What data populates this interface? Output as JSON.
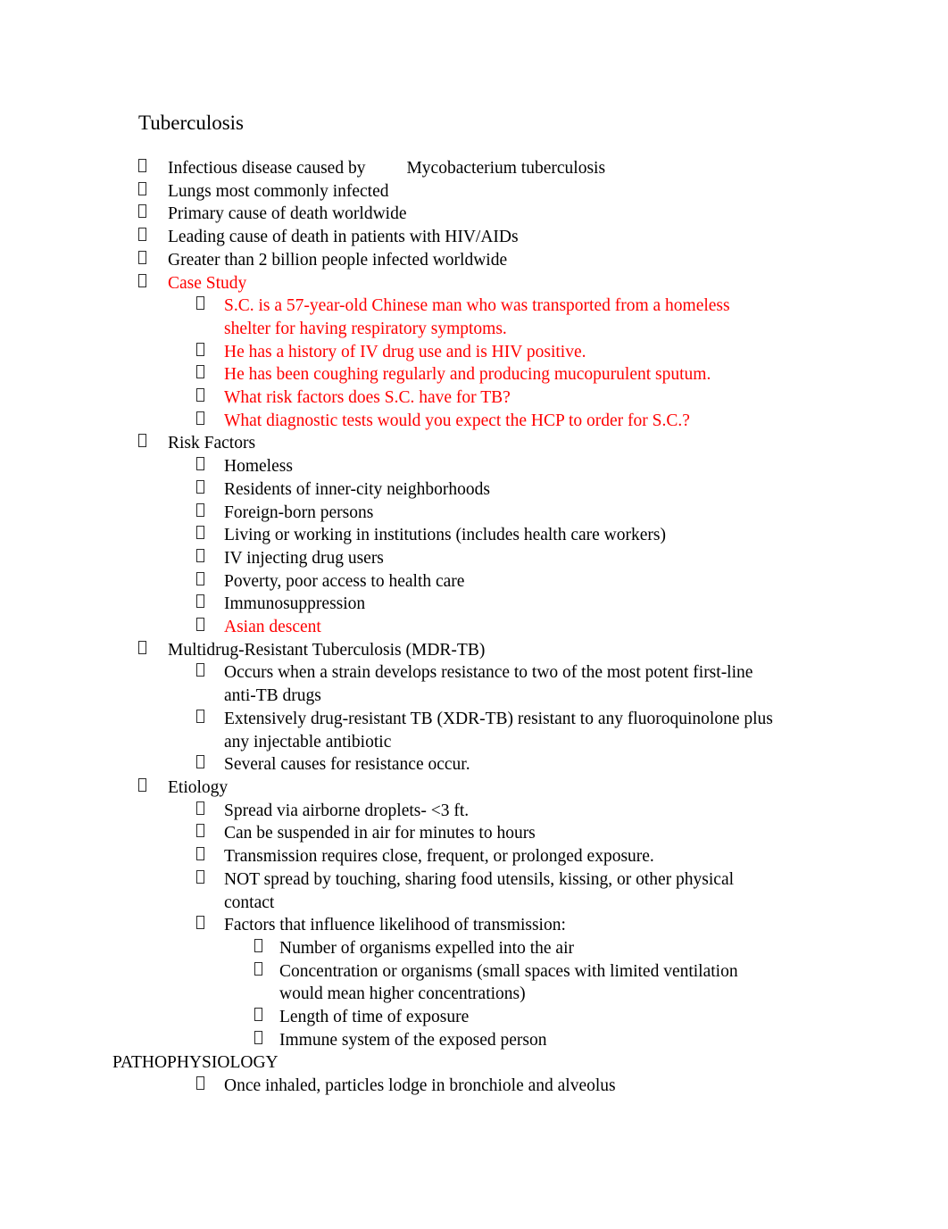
{
  "document": {
    "title": "Tuberculosis",
    "colors": {
      "text": "#000000",
      "highlight_red": "#ff0000",
      "background": "#ffffff",
      "bullet_outline": "#2b2b2b"
    },
    "bullet_glyph": "missing-glyph-box"
  },
  "outline": {
    "l1_infectious_a": "Infectious disease caused by",
    "l1_infectious_b": "Mycobacterium tuberculosis",
    "l1_lungs": "Lungs most commonly infected",
    "l1_primary_cause": "Primary cause of death worldwide",
    "l1_leading_cause": "Leading cause of death in patients with HIV/AIDs",
    "l1_greater_than": "Greater than 2 billion people infected worldwide",
    "l1_case_study": "Case Study",
    "case_study": {
      "item1": "S.C. is a 57-year-old Chinese man who was transported from a homeless shelter for having respiratory symptoms.",
      "item2": "He has a history of IV drug use and is HIV positive.",
      "item3": "He has been coughing regularly and producing mucopurulent sputum.",
      "item4": "What risk factors does S.C. have for TB?",
      "item5": "What diagnostic tests would you expect the HCP to order for S.C.?"
    },
    "l1_risk_factors": "Risk Factors",
    "risk_factors": {
      "item1": "Homeless",
      "item2": "Residents of inner-city neighborhoods",
      "item3": "Foreign-born persons",
      "item4": "Living or working in institutions (includes health care workers)",
      "item5": "IV injecting drug users",
      "item6": "Poverty, poor access to health care",
      "item7": "Immunosuppression",
      "item8": "Asian descent"
    },
    "l1_mdr_tb": "Multidrug-Resistant Tuberculosis (MDR-TB)",
    "mdr_tb": {
      "item1": "Occurs when a strain develops resistance to two of the most potent first-line anti-TB drugs",
      "item2": "Extensively drug-resistant TB (XDR-TB) resistant to any fluoroquinolone plus any injectable antibiotic",
      "item3": "Several causes for resistance occur."
    },
    "l1_etiology": "Etiology",
    "etiology": {
      "item1": "Spread via airborne droplets- <3 ft.",
      "item2": "Can be suspended in air for minutes to hours",
      "item3": "Transmission requires close, frequent, or prolonged exposure.",
      "item4": "NOT spread by touching, sharing food utensils, kissing, or other physical contact",
      "item5": "Factors that influence likelihood of transmission:",
      "factors": {
        "item1": "Number of organisms expelled into the air",
        "item2": "Concentration or organisms (small spaces with limited ventilation would mean higher concentrations)",
        "item3": "Length of time of exposure",
        "item4": "Immune system of the exposed person"
      }
    },
    "pathophysiology_heading": "PATHOPHYSIOLOGY",
    "pathophysiology": {
      "item1": "Once inhaled, particles lodge in bronchiole and alveolus"
    }
  }
}
